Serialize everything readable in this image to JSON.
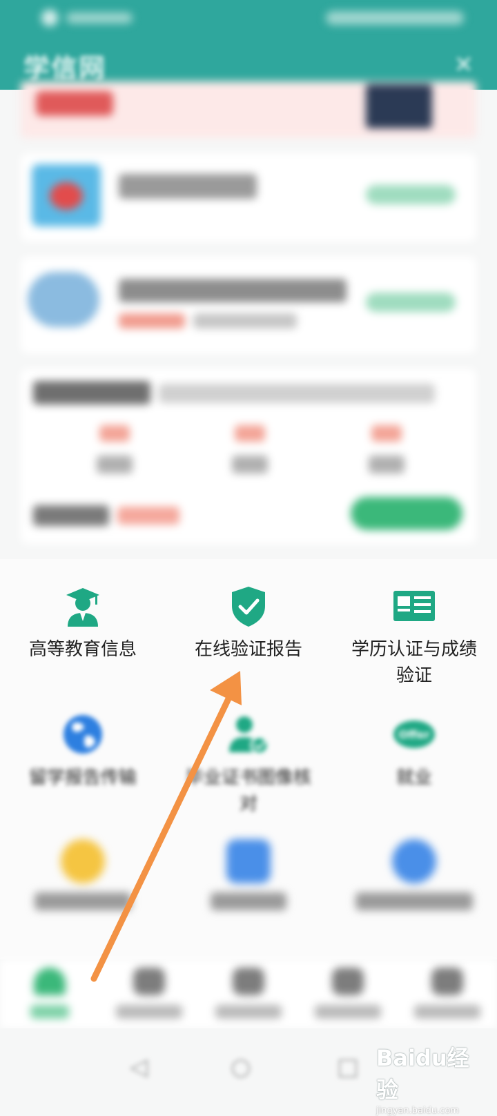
{
  "app": {
    "title": "学信网",
    "close_glyph": "✕"
  },
  "services": [
    {
      "label": "高等教育信息",
      "icon": "graduate-icon",
      "color": "#1fa884"
    },
    {
      "label": "在线验证报告",
      "icon": "shield-check-icon",
      "color": "#1fa884"
    },
    {
      "label": "学历认证与成绩验证",
      "icon": "certificate-card-icon",
      "color": "#1fa884"
    },
    {
      "label": "留学报告传输",
      "icon": "globe-icon",
      "color": "#2d7fe0"
    },
    {
      "label": "毕业证书图像核对",
      "icon": "person-check-icon",
      "color": "#1fa884"
    },
    {
      "label": "就业",
      "icon": "offer-icon",
      "color": "#1fa884",
      "icon_text": "Offer"
    }
  ],
  "annotation": {
    "arrow_color": "#f39244",
    "points_to": "在线验证报告"
  },
  "system_nav": {
    "back": "◁",
    "home": "○",
    "recent": "□"
  },
  "watermark": {
    "brand": "Baidu经验",
    "url": "jingyan.baidu.com"
  },
  "colors": {
    "primary": "#2fa79d",
    "accent": "#3bb87a"
  }
}
